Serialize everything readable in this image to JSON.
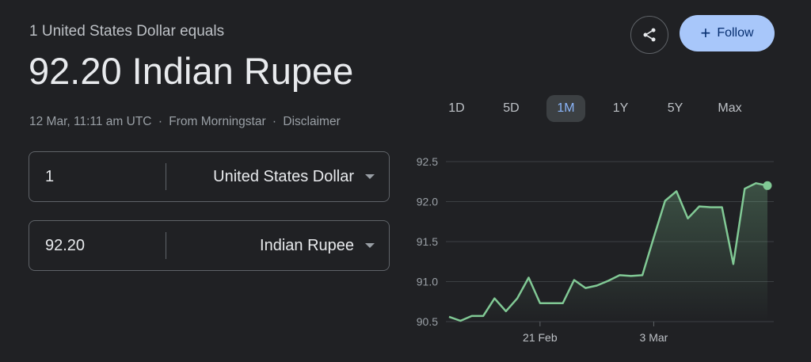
{
  "header": {
    "subtitle": "1 United States Dollar equals",
    "title": "92.20 Indian Rupee",
    "timestamp": "12 Mar, 11:11 am UTC",
    "separator": "·",
    "source": "From Morningstar",
    "disclaimer": "Disclaimer"
  },
  "converter": {
    "from": {
      "value": "1",
      "currency": "United States Dollar"
    },
    "to": {
      "value": "92.20",
      "currency": "Indian Rupee"
    }
  },
  "actions": {
    "share_icon": "share-icon",
    "follow_label": "Follow",
    "follow_color": "#a8c7fa"
  },
  "ranges": [
    "1D",
    "5D",
    "1M",
    "1Y",
    "5Y",
    "Max"
  ],
  "active_range": "1M",
  "chart_data": {
    "type": "area",
    "x_ticks": [
      "21 Feb",
      "3 Mar"
    ],
    "y_ticks": [
      "92.5",
      "92.0",
      "91.5",
      "91.0",
      "90.5"
    ],
    "ylim": [
      90.5,
      92.5
    ],
    "grid": true,
    "line_color": "#81c995",
    "series": [
      {
        "values": [
          90.56,
          90.51,
          90.57,
          90.57,
          90.79,
          90.63,
          90.79,
          91.05,
          90.73,
          90.73,
          90.73,
          91.02,
          90.92,
          90.95,
          91.01,
          91.08,
          91.07,
          91.08,
          91.55,
          92.01,
          92.13,
          91.79,
          91.94,
          91.93,
          91.93,
          91.22,
          92.16,
          92.23,
          92.2
        ]
      }
    ]
  }
}
